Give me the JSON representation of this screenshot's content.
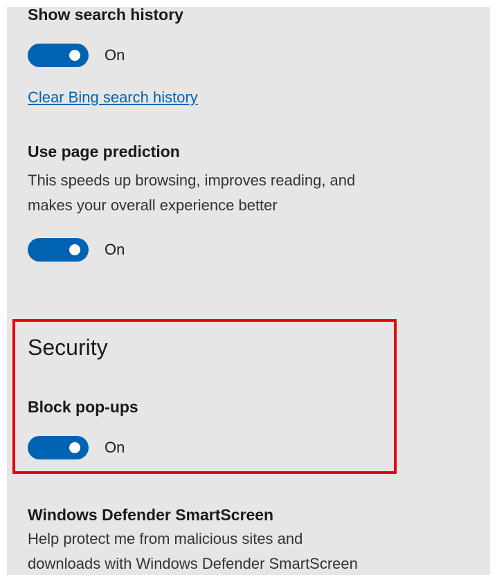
{
  "privacy": {
    "search_history": {
      "heading": "Show search history",
      "toggle_state": "On",
      "clear_link": "Clear Bing search history"
    },
    "page_prediction": {
      "heading": "Use page prediction",
      "description_line1": "This speeds up browsing, improves reading, and",
      "description_line2": "makes your overall experience better",
      "toggle_state": "On"
    }
  },
  "security": {
    "section_title": "Security",
    "block_popups": {
      "heading": "Block pop-ups",
      "toggle_state": "On"
    },
    "smartscreen": {
      "heading": "Windows Defender SmartScreen",
      "description_line1": "Help protect me from malicious sites and",
      "description_line2": "downloads with Windows Defender SmartScreen"
    }
  },
  "colors": {
    "accent": "#0063b1",
    "highlight_border": "#e8000b",
    "panel_background": "#e6e6e6"
  }
}
